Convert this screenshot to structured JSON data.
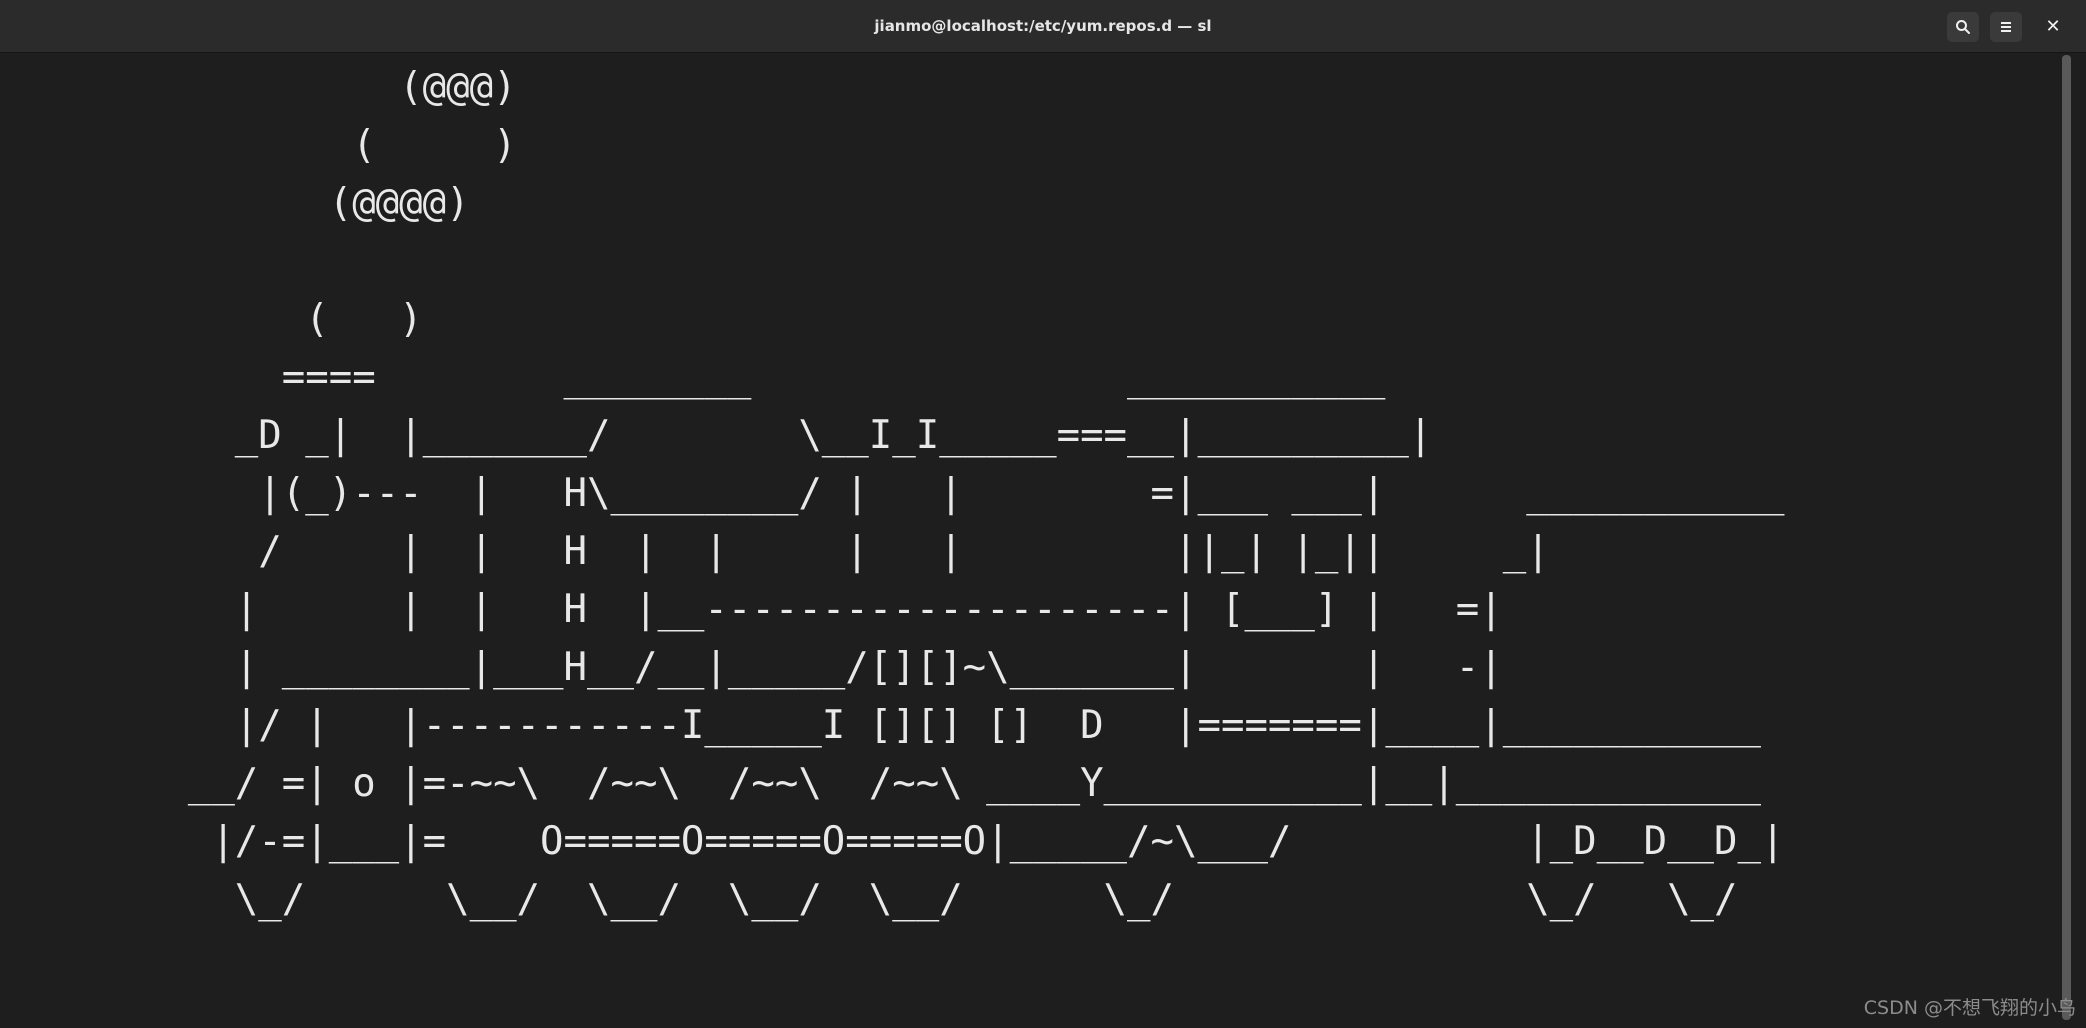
{
  "window": {
    "title": "jianmo@localhost:/etc/yum.repos.d — sl",
    "search_icon": "search-icon",
    "menu_icon": "hamburger-menu-icon",
    "close_label": "✕"
  },
  "terminal": {
    "lines": [
      "                 (@@@)",
      "               (     )",
      "              (@@@@)",
      "",
      "             (   )",
      "            ====        ________                ___________",
      "          _D _|  |_______/        \\__I_I_____===__|_________|",
      "           |(_)---  |   H\\________/ |   |        =|___ ___|      ___________",
      "           /     |  |   H  |  |     |   |         ||_| |_||     _|",
      "          |      |  |   H  |__--------------------| [___] |   =|",
      "          | ________|___H__/__|_____/[][]~\\_______|       |   -|",
      "          |/ |   |-----------I_____I [][] []  D   |=======|____|___________",
      "        __/ =| o |=-~~\\  /~~\\  /~~\\  /~~\\ ____Y___________|__|_____________",
      "         |/-=|___|=    O=====O=====O=====O|_____/~\\___/          |_D__D__D_|",
      "          \\_/      \\__/  \\__/  \\__/  \\__/      \\_/               \\_/   \\_/"
    ]
  },
  "watermark": "CSDN @不想飞翔的小鸟"
}
